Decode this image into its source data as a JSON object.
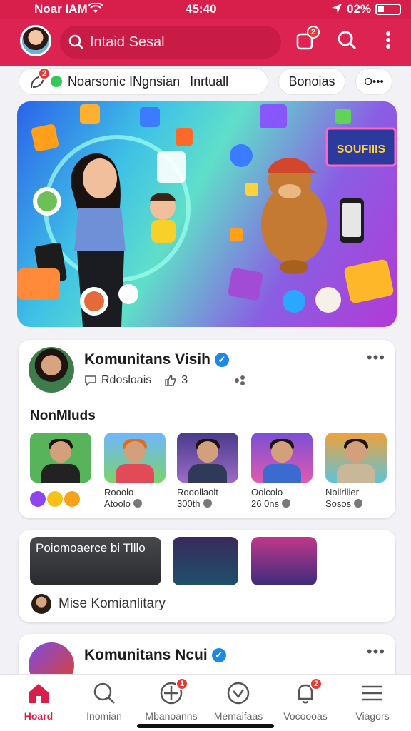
{
  "status_bar": {
    "carrier": "Noar IAM",
    "time": "45:40",
    "battery": "02%"
  },
  "header": {
    "search_placeholder": "Intaid Sesal",
    "notification_count": "2"
  },
  "chips": {
    "main_count": "2",
    "main_label": "Noarsonic INgnsian",
    "main_label_2": "Inrtuall",
    "second": "Bonoias",
    "third": "O•••"
  },
  "banner": {
    "sign_text": "SOUFIIIS"
  },
  "community_card": {
    "title": "Komunitans Visih",
    "meta_1": "Rdosloais",
    "meta_2": "3",
    "more_label": "•••",
    "section_title": "NonMluds",
    "thumbs": [
      {
        "caption_1": "",
        "caption_2": ""
      },
      {
        "caption_1": "Rooolo",
        "caption_2": "Atoolo"
      },
      {
        "caption_1": "Rooollaolt",
        "caption_2": "300th"
      },
      {
        "caption_1": "Oolcolo",
        "caption_2": "26 0ns"
      },
      {
        "caption_1": "Noilrllier",
        "caption_2": "Sosos"
      }
    ]
  },
  "videos_card": {
    "first_title": "Poiomoaerce bi Tlllo",
    "member_label": "Mise Komianlitary"
  },
  "community_card_2": {
    "title": "Komunitans Ncui",
    "more_label": "•••"
  },
  "bottom_nav": {
    "items": [
      {
        "label": "Hoard"
      },
      {
        "label": "Inomian"
      },
      {
        "label": "Mbanoanns",
        "badge": "1"
      },
      {
        "label": "Memaifaas"
      },
      {
        "label": "Vocoooas",
        "badge": "2"
      },
      {
        "label": "Viagors"
      }
    ]
  },
  "colors": {
    "brand": "#dc2352",
    "verified": "#1e88e5",
    "badge": "#e53935"
  },
  "icons": [
    "wifi-icon",
    "location-arrow-icon",
    "battery-icon",
    "search-icon",
    "notification-square-icon",
    "more-vertical-icon",
    "leaf-icon",
    "verified-icon",
    "chat-bubble-icon",
    "like-icon",
    "share-icon",
    "home-icon",
    "compass-icon",
    "people-icon",
    "heart-circle-icon",
    "bell-icon",
    "menu-icon"
  ]
}
